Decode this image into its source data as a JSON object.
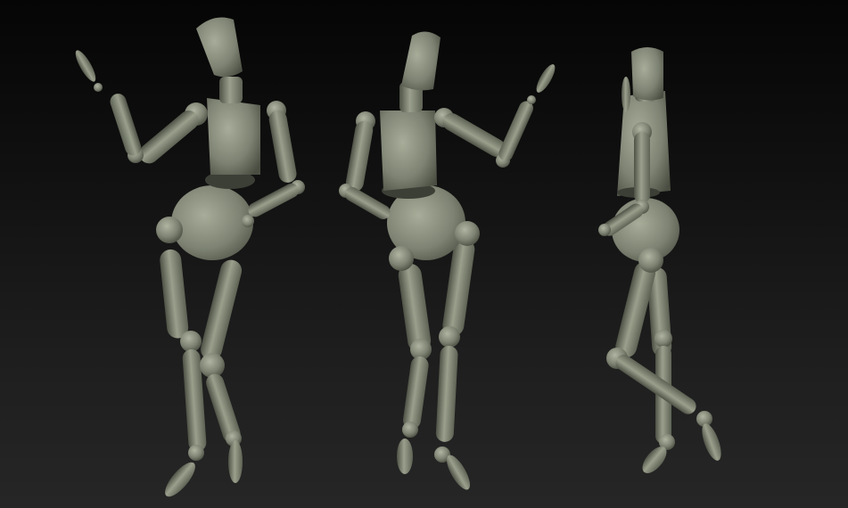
{
  "scene": {
    "subject": "mannequin",
    "figure_count": 3,
    "colors": {
      "background_top": "#050505",
      "background_bottom": "#262626",
      "body_fill": "#7d8272",
      "body_highlight": "#a3a896",
      "body_shadow": "#4a4e42",
      "joint_line": "#3a3d34"
    },
    "figures": [
      {
        "view": "front"
      },
      {
        "view": "back"
      },
      {
        "view": "side"
      }
    ]
  }
}
